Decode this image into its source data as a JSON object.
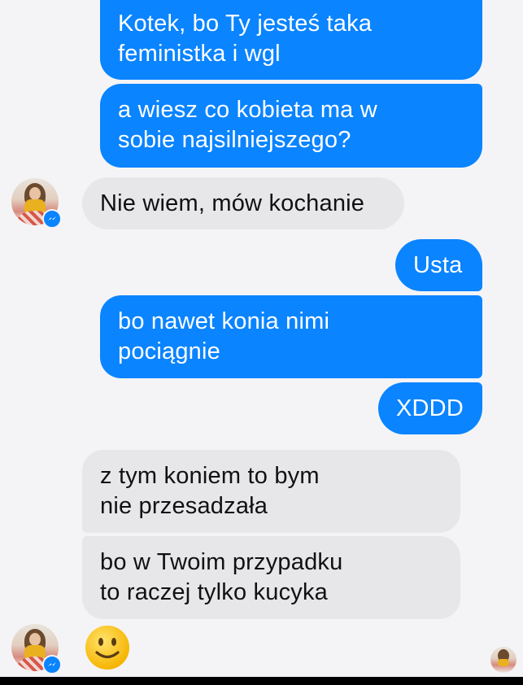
{
  "conversation": {
    "messages": [
      {
        "side": "outgoing",
        "lines": [
          "Kotek, bo Ty jesteś taka",
          "feministka i wgl"
        ]
      },
      {
        "side": "outgoing",
        "lines": [
          "a wiesz co kobieta ma w",
          "sobie najsilniejszego?"
        ]
      },
      {
        "side": "incoming",
        "lines": [
          "Nie wiem, mów kochanie"
        ]
      },
      {
        "side": "outgoing",
        "lines": [
          "Usta"
        ]
      },
      {
        "side": "outgoing",
        "lines": [
          "bo nawet konia nimi",
          "pociągnie"
        ]
      },
      {
        "side": "outgoing",
        "lines": [
          "XDDD"
        ]
      },
      {
        "side": "incoming",
        "lines": [
          "z tym koniem to bym",
          "nie przesadzała"
        ]
      },
      {
        "side": "incoming",
        "lines": [
          "bo w Twoim przypadku",
          "to raczej tylko kucyka"
        ]
      },
      {
        "side": "incoming",
        "emoji": "slightly-smiling-face"
      }
    ]
  },
  "icons": {
    "messenger_badge": "messenger-badge-icon",
    "smiley": "slightly-smiling-face-icon",
    "seen_receipt": "seen-avatar-icon"
  },
  "colors": {
    "outgoing_bubble": "#0a84ff",
    "incoming_bubble": "#e7e7ea",
    "background": "#f4f4f6"
  }
}
